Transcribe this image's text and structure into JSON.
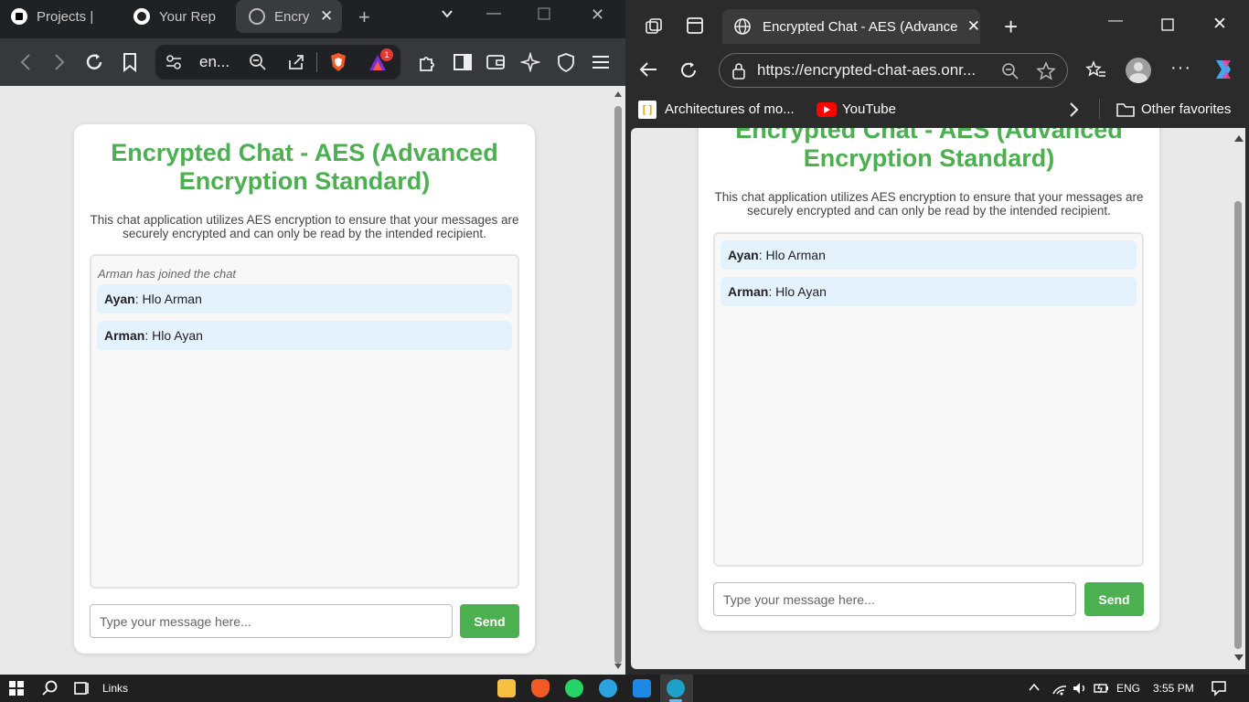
{
  "brave": {
    "tabs": [
      {
        "label": "Projects |",
        "icon": "notion-icon"
      },
      {
        "label": "Your Rep",
        "icon": "github-icon"
      },
      {
        "label": "Encry",
        "icon": "globe-icon",
        "active": true
      }
    ],
    "url": "en...",
    "notification_count": "1"
  },
  "edge": {
    "tab_title": "Encrypted Chat - AES (Advanced",
    "url": "https://encrypted-chat-aes.onr...",
    "favorites": [
      {
        "label": "Architectures of mo...",
        "icon": "bookmark-folder-icon"
      },
      {
        "label": "YouTube",
        "icon": "youtube-icon"
      }
    ],
    "other_favorites": "Other favorites"
  },
  "chat_left": {
    "title": "Encrypted Chat - AES (Advanced Encryption Standard)",
    "description": "This chat application utilizes AES encryption to ensure that your messages are securely encrypted and can only be read by the intended recipient.",
    "system_message": "Arman has joined the chat",
    "messages": [
      {
        "sender": "Ayan",
        "text": ": Hlo Arman"
      },
      {
        "sender": "Arman",
        "text": ": Hlo Ayan"
      }
    ],
    "input_placeholder": "Type your message here...",
    "send_label": "Send"
  },
  "chat_right": {
    "title": "Encrypted Chat - AES (Advanced Encryption Standard)",
    "description": "This chat application utilizes AES encryption to ensure that your messages are securely encrypted and can only be read by the intended recipient.",
    "messages": [
      {
        "sender": "Ayan",
        "text": ": Hlo Arman"
      },
      {
        "sender": "Arman",
        "text": ": Hlo Ayan"
      }
    ],
    "input_placeholder": "Type your message here...",
    "send_label": "Send"
  },
  "taskbar": {
    "links_label": "Links",
    "language": "ENG",
    "time": "3:55 PM"
  },
  "colors": {
    "accent_green": "#4caf50",
    "message_bg": "#e4f2fe"
  }
}
